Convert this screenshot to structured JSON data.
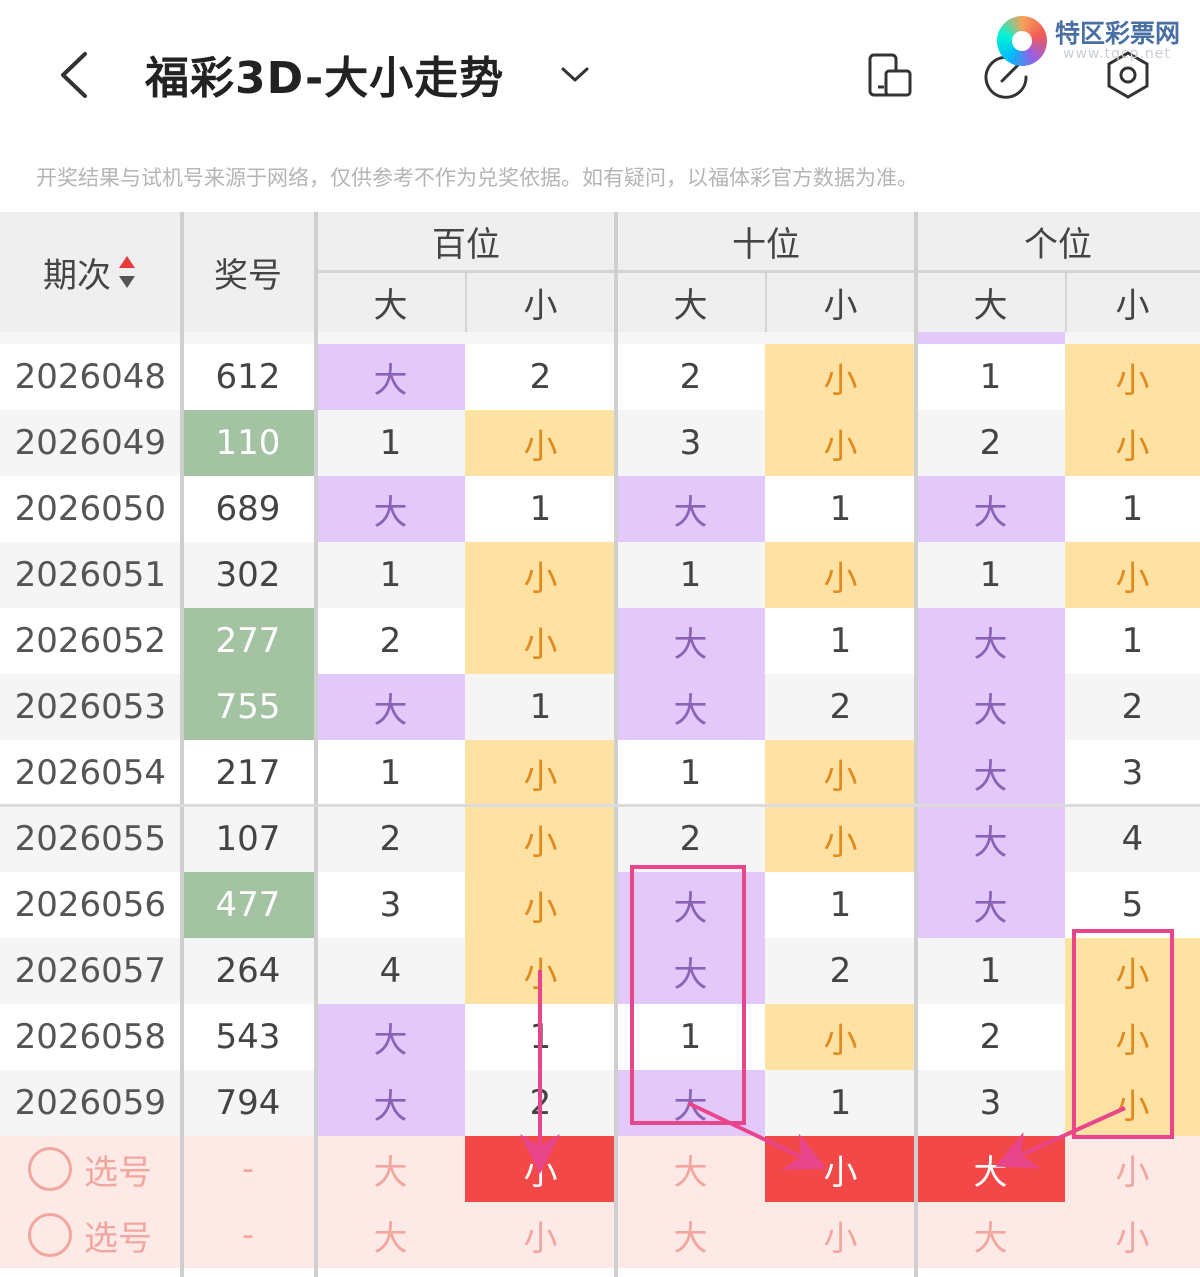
{
  "header": {
    "title": "福彩3D-大小走势",
    "back_icon": "chevron-left-icon",
    "dropdown_icon": "chevron-down-icon",
    "icons": [
      "phone-tablet-icon",
      "edit-icon",
      "settings-icon"
    ]
  },
  "logo": {
    "name": "特区彩票网",
    "sub": "www.tqcp.net"
  },
  "disclaimer": "开奖结果与试机号来源于网络，仅供参考不作为兑奖依据。如有疑问，以福体彩官方数据为准。",
  "table": {
    "col_period": "期次",
    "col_number": "奖号",
    "groups": [
      "百位",
      "十位",
      "个位"
    ],
    "sub": [
      "大",
      "小"
    ],
    "rows": [
      {
        "period": "2026048",
        "number": "612",
        "green": false,
        "b": [
          "大",
          "2"
        ],
        "s": [
          "2",
          "小"
        ],
        "g": [
          "1",
          "小"
        ]
      },
      {
        "period": "2026049",
        "number": "110",
        "green": true,
        "b": [
          "1",
          "小"
        ],
        "s": [
          "3",
          "小"
        ],
        "g": [
          "2",
          "小"
        ]
      },
      {
        "period": "2026050",
        "number": "689",
        "green": false,
        "b": [
          "大",
          "1"
        ],
        "s": [
          "大",
          "1"
        ],
        "g": [
          "大",
          "1"
        ]
      },
      {
        "period": "2026051",
        "number": "302",
        "green": false,
        "b": [
          "1",
          "小"
        ],
        "s": [
          "1",
          "小"
        ],
        "g": [
          "1",
          "小"
        ]
      },
      {
        "period": "2026052",
        "number": "277",
        "green": true,
        "b": [
          "2",
          "小"
        ],
        "s": [
          "大",
          "1"
        ],
        "g": [
          "大",
          "1"
        ]
      },
      {
        "period": "2026053",
        "number": "755",
        "green": true,
        "b": [
          "大",
          "1"
        ],
        "s": [
          "大",
          "2"
        ],
        "g": [
          "大",
          "2"
        ]
      },
      {
        "period": "2026054",
        "number": "217",
        "green": false,
        "b": [
          "1",
          "小"
        ],
        "s": [
          "1",
          "小"
        ],
        "g": [
          "大",
          "3"
        ]
      },
      {
        "period": "2026055",
        "number": "107",
        "green": false,
        "b": [
          "2",
          "小"
        ],
        "s": [
          "2",
          "小"
        ],
        "g": [
          "大",
          "4"
        ]
      },
      {
        "period": "2026056",
        "number": "477",
        "green": true,
        "b": [
          "3",
          "小"
        ],
        "s": [
          "大",
          "1"
        ],
        "g": [
          "大",
          "5"
        ]
      },
      {
        "period": "2026057",
        "number": "264",
        "green": false,
        "b": [
          "4",
          "小"
        ],
        "s": [
          "大",
          "2"
        ],
        "g": [
          "1",
          "小"
        ]
      },
      {
        "period": "2026058",
        "number": "543",
        "green": false,
        "b": [
          "大",
          "1"
        ],
        "s": [
          "1",
          "小"
        ],
        "g": [
          "2",
          "小"
        ]
      },
      {
        "period": "2026059",
        "number": "794",
        "green": false,
        "b": [
          "大",
          "2"
        ],
        "s": [
          "大",
          "1"
        ],
        "g": [
          "3",
          "小"
        ]
      }
    ],
    "select_rows": [
      {
        "label": "选号",
        "number": "-",
        "cells": [
          "大",
          "小",
          "大",
          "小",
          "大",
          "小"
        ],
        "selected": [
          1,
          3,
          4
        ]
      },
      {
        "label": "选号",
        "number": "-",
        "cells": [
          "大",
          "小",
          "大",
          "小",
          "大",
          "小"
        ],
        "selected": []
      }
    ]
  },
  "colors": {
    "big": "#e3c9fa",
    "small": "#fde2a4",
    "green": "#a4c3a2",
    "red": "#f24848",
    "annotation": "#e8458b"
  }
}
